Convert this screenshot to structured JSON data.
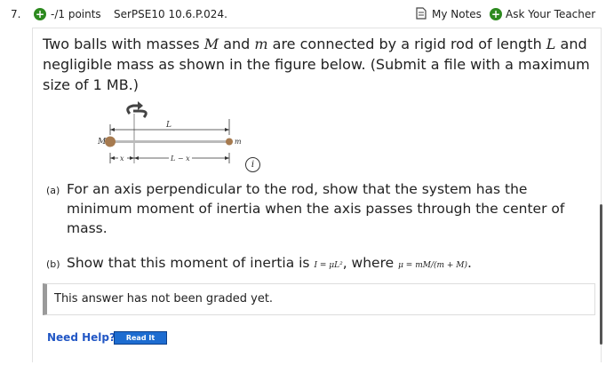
{
  "header": {
    "question_number": "7.",
    "points_icon": "plus-circle-icon",
    "points": "-/1 points",
    "question_id": "SerPSE10 10.6.P.024.",
    "my_notes": "My Notes",
    "ask_teacher": "Ask Your Teacher"
  },
  "question": {
    "stem_part1": "Two balls with masses ",
    "M": "M",
    "and": " and ",
    "m": "m",
    "stem_part2": " are connected by a rigid rod of length ",
    "L": "L",
    "stem_part3": " and negligible mass as shown in the figure below. (Submit a file with a maximum size of 1 MB.)"
  },
  "figure": {
    "label_L": "L",
    "label_M": "M",
    "label_m": "m",
    "label_x": "x",
    "label_Lminusx": "L − x"
  },
  "parts": [
    {
      "label": "(a)",
      "text": "For an axis perpendicular to the rod, show that the system has the minimum moment of inertia when the axis passes through the center of mass."
    },
    {
      "label": "(b)",
      "text_before": "Show that this moment of inertia is ",
      "formula1": "I = μL²",
      "text_mid": ", where ",
      "formula2": "μ = mM/(m + M)",
      "text_end": "."
    }
  ],
  "answer": {
    "status": "This answer has not been graded yet."
  },
  "help": {
    "label": "Need Help?",
    "read_button": "Read It"
  },
  "colors": {
    "accent_green": "#2d8a1f",
    "link_blue": "#2257c5",
    "button_blue": "#1d6cd0"
  }
}
